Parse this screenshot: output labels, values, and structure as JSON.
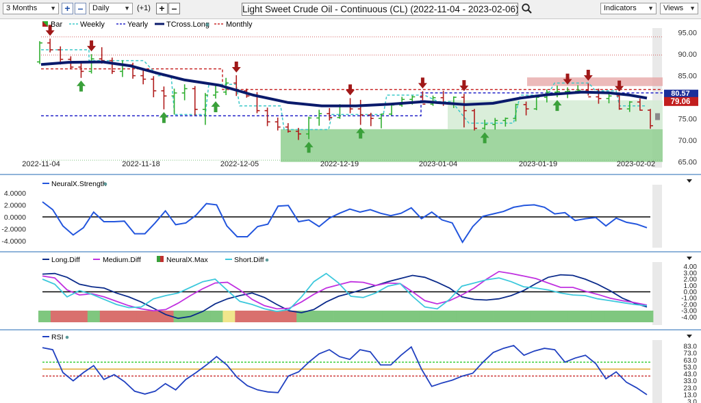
{
  "toolbar": {
    "period": "3 Months",
    "interval": "Daily",
    "offset": "(+1)",
    "title": "Light Sweet Crude Oil - Continuous (CL) (2022-11-04 - 2023-02-06)",
    "indicators": "Indicators",
    "views": "Views"
  },
  "colors": {
    "up": "#2fae2f",
    "down": "#b01c1c",
    "tcross": "#0a1a6b",
    "weekly": "#3cc8c8",
    "yearly": "#2323c8",
    "monthly": "#c82828",
    "strength": "#2255dd",
    "long": "#0a2a8a",
    "medium": "#c030e0",
    "short": "#3cc8dc",
    "rsi": "#2040c0",
    "zone": "#8fcf8f",
    "neg_bar": "#d9706e",
    "pos_bar": "#7fc77f",
    "neu_bar": "#f0e68c"
  },
  "chart_data": [
    {
      "type": "candlestick",
      "legend": [
        "Bar",
        "Weekly",
        "Yearly",
        "TCross.Long",
        "Monthly"
      ],
      "x_tick_labels": [
        "2022-11-04",
        "2022-11-18",
        "2022-12-05",
        "2022-12-19",
        "2023-01-04",
        "2023-01-19",
        "2023-02-02"
      ],
      "y_tick_labels": [
        "95.00",
        "90.00",
        "85.00",
        "80.00",
        "75.00",
        "70.00",
        "65.00"
      ],
      "ylim": [
        64,
        97
      ],
      "last_price_label": "79.06",
      "tcross_label": "80.57",
      "candles": [
        [
          88.2,
          93.0,
          87.7,
          92.6
        ],
        [
          92.6,
          93.6,
          90.4,
          91.0
        ],
        [
          91.0,
          91.8,
          87.6,
          88.8
        ],
        [
          88.8,
          89.5,
          86.5,
          87.0
        ],
        [
          87.0,
          88.2,
          84.5,
          86.0
        ],
        [
          86.0,
          90.0,
          85.5,
          88.9
        ],
        [
          88.9,
          91.6,
          87.8,
          88.5
        ],
        [
          88.5,
          89.2,
          85.4,
          86.0
        ],
        [
          86.0,
          88.6,
          84.7,
          87.5
        ],
        [
          87.5,
          88.0,
          84.3,
          85.0
        ],
        [
          85.0,
          86.5,
          83.0,
          84.2
        ],
        [
          84.2,
          84.9,
          80.0,
          81.5
        ],
        [
          81.5,
          82.5,
          77.2,
          80.3
        ],
        [
          80.3,
          82.0,
          76.0,
          81.0
        ],
        [
          81.0,
          83.0,
          79.3,
          82.0
        ],
        [
          82.0,
          82.6,
          75.8,
          77.2
        ],
        [
          77.2,
          81.0,
          73.6,
          80.5
        ],
        [
          80.5,
          82.8,
          79.7,
          81.2
        ],
        [
          81.2,
          84.5,
          80.5,
          83.3
        ],
        [
          83.3,
          85.1,
          80.3,
          81.5
        ],
        [
          81.5,
          82.0,
          79.9,
          80.3
        ],
        [
          80.3,
          81.2,
          76.3,
          76.9
        ],
        [
          76.9,
          77.6,
          73.3,
          74.3
        ],
        [
          74.3,
          75.3,
          72.3,
          73.1
        ],
        [
          73.1,
          74.0,
          71.8,
          72.1
        ],
        [
          72.1,
          72.9,
          70.1,
          71.5
        ],
        [
          71.5,
          75.5,
          70.3,
          75.2
        ],
        [
          75.2,
          77.1,
          73.4,
          76.2
        ],
        [
          76.2,
          77.5,
          74.6,
          75.3
        ],
        [
          75.3,
          78.4,
          75.0,
          77.9
        ],
        [
          77.9,
          79.8,
          76.3,
          77.3
        ],
        [
          77.3,
          79.4,
          73.6,
          75.9
        ],
        [
          75.9,
          76.4,
          73.3,
          75.1
        ],
        [
          75.1,
          76.2,
          72.8,
          76.1
        ],
        [
          76.1,
          78.3,
          75.8,
          78.2
        ],
        [
          78.2,
          80.1,
          77.8,
          79.5
        ],
        [
          79.5,
          80.4,
          78.3,
          80.1
        ],
        [
          80.1,
          81.4,
          79.2,
          78.4
        ],
        [
          78.4,
          80.4,
          78.0,
          79.9
        ],
        [
          79.9,
          81.5,
          78.0,
          78.5
        ],
        [
          78.5,
          80.2,
          77.5,
          80.0
        ],
        [
          80.0,
          80.8,
          73.0,
          76.9
        ],
        [
          76.9,
          77.3,
          72.3,
          72.8
        ],
        [
          72.8,
          74.8,
          72.5,
          73.7
        ],
        [
          73.7,
          75.2,
          72.5,
          74.6
        ],
        [
          74.6,
          75.3,
          73.2,
          75.1
        ],
        [
          75.1,
          78.5,
          74.4,
          78.3
        ],
        [
          78.3,
          79.0,
          75.8,
          77.3
        ],
        [
          77.3,
          80.2,
          77.0,
          80.0
        ],
        [
          80.0,
          81.8,
          78.8,
          81.2
        ],
        [
          81.2,
          82.7,
          80.0,
          81.3
        ],
        [
          81.3,
          82.3,
          79.8,
          81.4
        ],
        [
          81.4,
          82.8,
          80.8,
          81.6
        ],
        [
          81.6,
          83.2,
          80.4,
          80.1
        ],
        [
          80.1,
          82.0,
          78.5,
          79.7
        ],
        [
          79.7,
          81.2,
          78.6,
          80.3
        ],
        [
          80.3,
          80.7,
          77.1,
          77.3
        ],
        [
          77.3,
          79.1,
          76.6,
          78.9
        ],
        [
          78.9,
          79.7,
          76.9,
          77.0
        ],
        [
          77.0,
          77.3,
          72.7,
          73.4
        ]
      ],
      "arrows_down_index": [
        1,
        5,
        19,
        30,
        37,
        41,
        51,
        53,
        56
      ],
      "arrows_up_index": [
        4,
        12,
        17,
        26,
        31,
        43,
        50
      ]
    },
    {
      "type": "line",
      "legend": [
        "NeuralX.Strength"
      ],
      "y_tick_labels": [
        "4.0000",
        "2.0000",
        "0.0000",
        "-2.0000",
        "-4.0000"
      ],
      "ylim": [
        -5,
        5
      ],
      "series": [
        {
          "name": "NeuralX.Strength",
          "values": [
            2.5,
            1.2,
            -1.5,
            -3.0,
            -1.8,
            0.8,
            -0.8,
            -0.8,
            -0.7,
            -2.8,
            -2.8,
            -1.0,
            1.0,
            -1.3,
            -1.0,
            0.3,
            2.2,
            2.0,
            -1.5,
            -3.3,
            -3.3,
            -1.6,
            -1.2,
            1.8,
            1.9,
            -0.8,
            -0.5,
            -1.6,
            -0.2,
            0.6,
            1.3,
            0.8,
            1.2,
            0.6,
            0.2,
            0.6,
            1.5,
            -0.3,
            0.8,
            -0.5,
            -1.0,
            -4.2,
            -1.6,
            0.1,
            0.5,
            0.9,
            1.6,
            1.9,
            2.0,
            1.6,
            0.5,
            0.7,
            -0.6,
            -0.3,
            -0.1,
            -1.5,
            -0.2,
            -0.9,
            -1.2,
            -1.8
          ]
        }
      ]
    },
    {
      "type": "line",
      "legend": [
        "Long.Diff",
        "Medium.Diff",
        "NeuralX.Max",
        "Short.Diff"
      ],
      "y_tick_labels": [
        "4.00",
        "3.00",
        "2.00",
        "1.00",
        "0.00",
        "-1.00",
        "-2.00",
        "-3.00",
        "-4.00"
      ],
      "ylim": [
        -4.6,
        4.6
      ],
      "series": [
        {
          "name": "Long.Diff",
          "values": [
            2.8,
            2.9,
            2.3,
            1.2,
            0.8,
            0.6,
            -0.2,
            -0.8,
            -1.6,
            -2.6,
            -3.6,
            -4.2,
            -3.9,
            -3.1,
            -1.9,
            -1.1,
            -0.6,
            -0.2,
            -0.9,
            -2.0,
            -3.0,
            -3.3,
            -2.8,
            -1.6,
            -0.7,
            -0.2,
            0.4,
            1.0,
            1.6,
            2.1,
            2.6,
            2.3,
            1.5,
            0.6,
            -0.8,
            -1.2,
            -1.3,
            -1.1,
            -0.6,
            0.2,
            1.3,
            2.3,
            2.7,
            2.6,
            2.0,
            1.2,
            0.2,
            -1.0,
            -1.8,
            -2.4
          ]
        },
        {
          "name": "Medium.Diff",
          "values": [
            2.5,
            2.2,
            0.3,
            -0.5,
            -0.3,
            -0.8,
            -1.5,
            -2.2,
            -2.7,
            -3.0,
            -2.8,
            -1.8,
            -0.6,
            0.5,
            1.4,
            1.5,
            0.3,
            -1.2,
            -2.2,
            -2.7,
            -2.6,
            -1.6,
            -0.4,
            0.6,
            1.1,
            1.6,
            1.5,
            1.0,
            1.4,
            1.3,
            0.0,
            -1.4,
            -1.9,
            -1.4,
            -0.5,
            0.6,
            2.0,
            3.2,
            2.9,
            2.5,
            2.1,
            1.4,
            0.7,
            0.7,
            0.1,
            -0.4,
            -1.0,
            -1.4,
            -1.7,
            -2.1
          ]
        },
        {
          "name": "Short.Diff",
          "values": [
            2.0,
            1.2,
            -0.8,
            0.2,
            -0.4,
            -1.2,
            -2.0,
            -2.5,
            -2.4,
            -1.1,
            -0.6,
            -0.2,
            0.7,
            1.6,
            2.0,
            0.2,
            -1.5,
            -2.0,
            -2.7,
            -3.1,
            -2.8,
            -0.8,
            1.6,
            2.9,
            1.4,
            -0.7,
            -0.9,
            -0.2,
            0.9,
            1.3,
            -0.7,
            -2.4,
            -2.7,
            -1.2,
            0.9,
            1.4,
            1.9,
            2.2,
            1.6,
            0.8,
            0.6,
            0.3,
            -0.2,
            -0.5,
            -0.6,
            -1.1,
            -1.4,
            -1.7,
            -2.0,
            -2.2
          ]
        }
      ],
      "neuralx_max_segments": [
        "pos",
        "neg",
        "neg",
        "neg",
        "pos",
        "neg",
        "neg",
        "neg",
        "neg",
        "neg",
        "neg",
        "pos",
        "pos",
        "pos",
        "pos",
        "neu",
        "neg",
        "neg",
        "neg",
        "neg",
        "neg",
        "pos",
        "pos",
        "pos",
        "pos",
        "pos",
        "pos",
        "pos",
        "pos",
        "pos",
        "pos",
        "pos",
        "pos",
        "pos",
        "pos",
        "pos",
        "pos",
        "pos",
        "pos",
        "pos",
        "pos",
        "pos",
        "pos",
        "pos",
        "pos",
        "pos",
        "pos",
        "pos",
        "pos",
        "pos"
      ]
    },
    {
      "type": "line",
      "legend": [
        "RSI"
      ],
      "y_tick_labels": [
        "83.0",
        "73.0",
        "63.0",
        "53.0",
        "43.0",
        "33.0",
        "23.0",
        "13.0",
        "3.0"
      ],
      "ylim": [
        3,
        88
      ],
      "levels": [
        60,
        50,
        40
      ],
      "series": [
        {
          "name": "RSI",
          "values": [
            81,
            78,
            45,
            33,
            45,
            55,
            35,
            42,
            32,
            18,
            14,
            18,
            29,
            20,
            35,
            45,
            56,
            68,
            56,
            38,
            26,
            20,
            17,
            16,
            40,
            46,
            60,
            72,
            78,
            68,
            64,
            78,
            75,
            56,
            56,
            70,
            82,
            50,
            25,
            30,
            34,
            40,
            44,
            60,
            74,
            80,
            84,
            70,
            76,
            80,
            78,
            60,
            66,
            70,
            58,
            36,
            46,
            31,
            23,
            13
          ]
        }
      ]
    }
  ]
}
